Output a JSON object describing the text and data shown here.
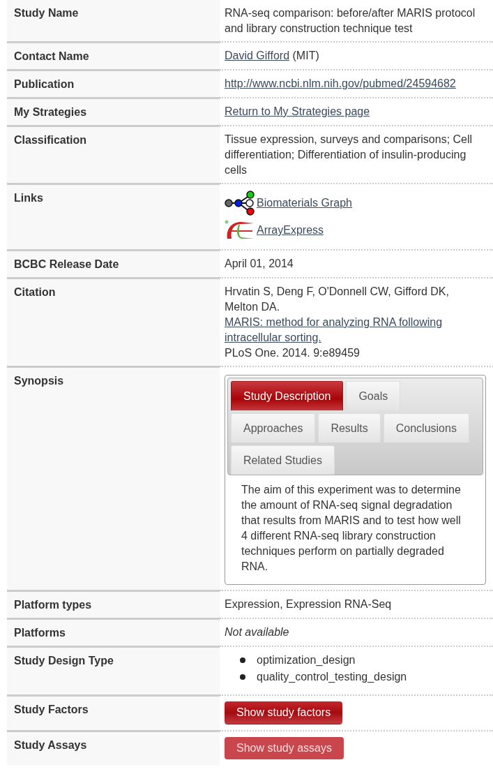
{
  "rows": [
    {
      "label": "Study Name",
      "kind": "text",
      "text": "RNA-seq comparison: before/after MARIS protocol and library construction technique test"
    },
    {
      "label": "Contact Name",
      "kind": "parts",
      "parts": [
        {
          "text": "David Gifford",
          "link": true
        },
        {
          "text": " (MIT)",
          "link": false
        }
      ]
    },
    {
      "label": "Publication",
      "kind": "parts",
      "parts": [
        {
          "text": "http://www.ncbi.nlm.nih.gov/pubmed/24594682",
          "link": true
        }
      ]
    },
    {
      "label": "My Strategies",
      "kind": "parts",
      "parts": [
        {
          "text": "Return to My Strategies page",
          "link": true
        }
      ]
    },
    {
      "label": "Classification",
      "kind": "text",
      "text": "Tissue expression, surveys and comparisons; Cell differentiation; Differentiation of insulin-producing cells"
    },
    {
      "label": "Links",
      "kind": "links",
      "links": [
        {
          "text": "Biomaterials Graph",
          "kind": "graph"
        },
        {
          "text": "ArrayExpress",
          "kind": "ae"
        }
      ]
    },
    {
      "label": "BCBC Release Date",
      "kind": "text",
      "text": "April 01, 2014"
    },
    {
      "label": "Citation",
      "kind": "parts",
      "parts": [
        {
          "text": "Hrvatin S, Deng F, O'Donnell CW, Gifford DK, Melton DA. ",
          "link": false
        },
        {
          "text": "MARIS: method for analyzing RNA following intracellular sorting.",
          "link": true
        },
        {
          "text": " PLoS One. 2014. 9:e89459",
          "link": false
        }
      ]
    },
    {
      "label": "Synopsis",
      "kind": "tabs",
      "tabs": [
        {
          "label": "Study Description",
          "selected": true
        },
        {
          "label": "Goals",
          "selected": false
        },
        {
          "label": "Approaches",
          "selected": false
        },
        {
          "label": "Results",
          "selected": false
        },
        {
          "label": "Conclusions",
          "selected": false
        },
        {
          "label": "Related Studies",
          "selected": false
        }
      ],
      "body": "The aim of this experiment was to determine the amount of RNA-seq signal degradation that results from MARIS and to test how well 4 different RNA-seq library construction techniques perform on partially degraded RNA."
    },
    {
      "label": "Platform types",
      "kind": "text",
      "text": "Expression, Expression RNA-Seq"
    },
    {
      "label": "Platforms",
      "kind": "note",
      "text": "Not available"
    },
    {
      "label": "Study Design Type",
      "kind": "list",
      "items": [
        "optimization_design",
        "quality_control_testing_design"
      ]
    },
    {
      "label": "Study Factors",
      "kind": "button",
      "button": {
        "label": "Show study factors",
        "disabled": false
      }
    },
    {
      "label": "Study Assays",
      "kind": "button",
      "button": {
        "label": "Show study assays",
        "disabled": true
      }
    }
  ]
}
